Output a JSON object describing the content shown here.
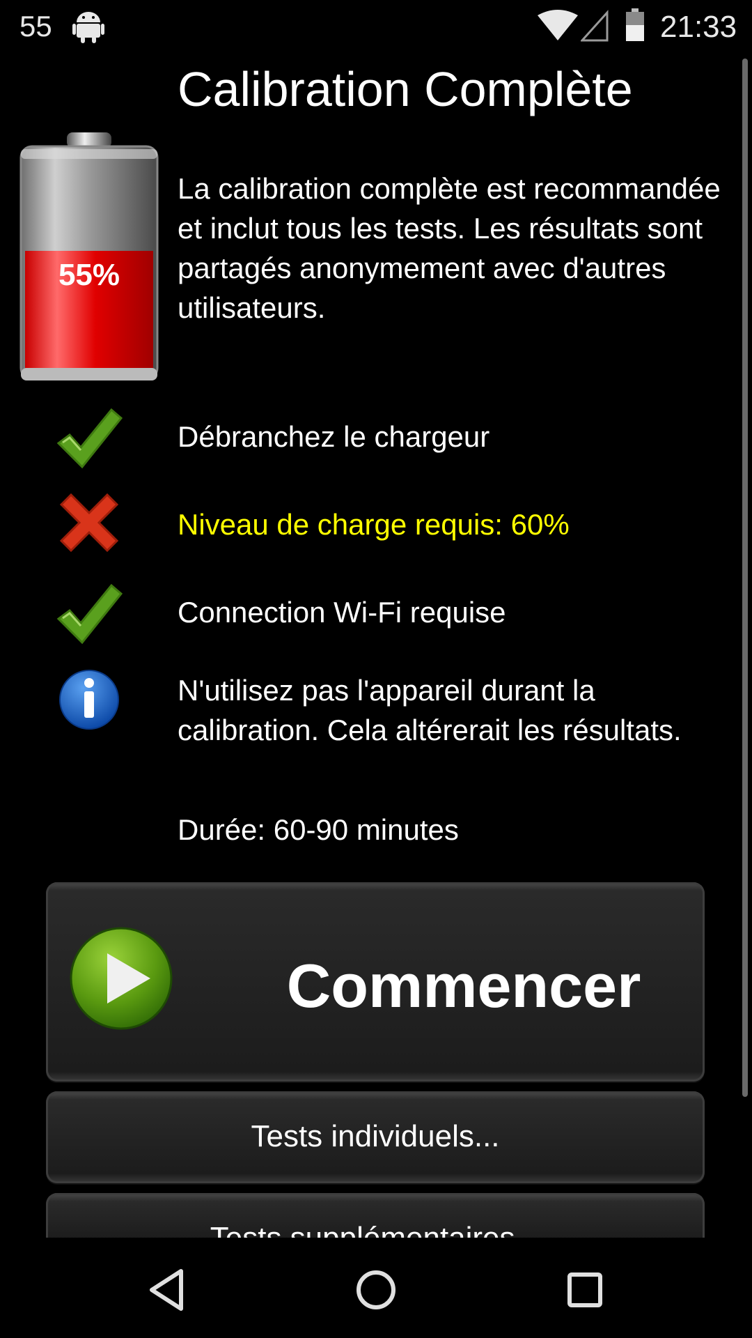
{
  "status_bar": {
    "notification_count": "55",
    "time": "21:33"
  },
  "header": {
    "title": "Calibration Complète"
  },
  "battery": {
    "percent_label": "55%",
    "level": 0.55
  },
  "description": "La calibration complète est recommandée et inclut tous les tests. Les résultats sont partagés anonymement avec d'autres utilisateurs.",
  "requirements": [
    {
      "status": "ok",
      "icon": "checkmark-icon",
      "text": "Débranchez le chargeur"
    },
    {
      "status": "fail",
      "icon": "cross-icon",
      "text": "Niveau de charge requis: 60%"
    },
    {
      "status": "ok",
      "icon": "checkmark-icon",
      "text": "Connection Wi-Fi requise"
    },
    {
      "status": "info",
      "icon": "info-icon",
      "text": "N'utilisez pas l'appareil durant la calibration. Cela altérerait les résultats."
    }
  ],
  "duration": "Durée: 60-90 minutes",
  "buttons": {
    "start_label": "Commencer",
    "individual_tests_label": "Tests individuels...",
    "additional_tests_label": "Tests supplémentaires..."
  },
  "colors": {
    "warning_text": "#ffff00",
    "battery_fill": "#e00000",
    "check_green": "#5aa01e",
    "cross_red": "#d9341a",
    "info_blue": "#1a63c8"
  }
}
